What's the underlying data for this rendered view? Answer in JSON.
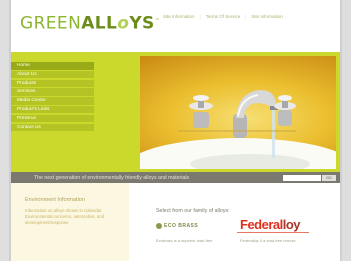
{
  "header": {
    "logo": {
      "part1": "GREEN",
      "part2": "ALL",
      "part3": "Y",
      "part4": "S",
      "tm": "™"
    },
    "top_links": [
      "Site Information",
      "Terms Of Service",
      "Site Information"
    ]
  },
  "nav": {
    "items": [
      "Home",
      "About Us",
      "Products",
      "Services",
      "Media Center",
      "Product's Links",
      "Pressrun",
      "Contact Us"
    ]
  },
  "tagline": "The next generation of environmentally friendly alloys and materials",
  "search": {
    "button_label": "GO"
  },
  "left_col": {
    "title": "Environment Information",
    "links": [
      "Information on alloys shown in Calendar",
      "Environmental concerns, automotive, and",
      "development/response"
    ]
  },
  "right_col": {
    "select_label": "Select from our family of alloys:",
    "brand1": "ECO BRASS",
    "brand2_a": "Federal",
    "brand2_b": "loy",
    "blurb1": "Ecobrass is a superior lead-free",
    "blurb2": "Federalloy II a lead-free bronze"
  },
  "colors": {
    "brand_green": "#8bb52c",
    "hero_green": "#cad92b",
    "tagbar": "#7b786f",
    "brand_red": "#e0301e"
  }
}
